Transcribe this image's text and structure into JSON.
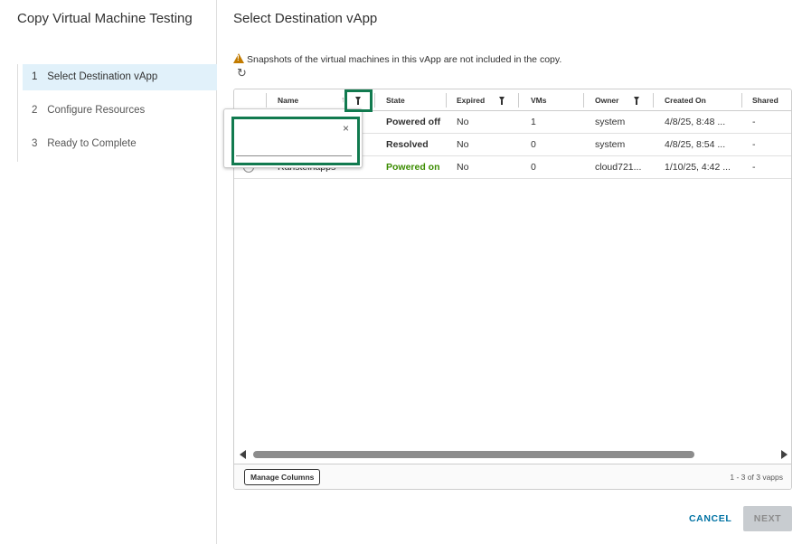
{
  "wizard": {
    "title": "Copy Virtual Machine Testing",
    "steps": [
      {
        "num": "1",
        "label": "Select Destination vApp"
      },
      {
        "num": "2",
        "label": "Configure Resources"
      },
      {
        "num": "3",
        "label": "Ready to Complete"
      }
    ]
  },
  "main": {
    "title": "Select Destination vApp",
    "warning": "Snapshots of the virtual machines in this vApp are not included in the copy.",
    "refresh_icon": "↻"
  },
  "grid": {
    "columns": {
      "name": "Name",
      "state": "State",
      "expired": "Expired",
      "vms": "VMs",
      "owner": "Owner",
      "created_on": "Created On",
      "shared": "Shared"
    },
    "sort_icon": "↑",
    "rows": [
      {
        "name": "",
        "state": "Powered off",
        "expired": "No",
        "vms": "1",
        "owner": "system",
        "created_on": "4/8/25, 8:48 ...",
        "shared": "-"
      },
      {
        "name": "",
        "state": "Resolved",
        "expired": "No",
        "vms": "0",
        "owner": "system",
        "created_on": "4/8/25, 8:54 ...",
        "shared": "-"
      },
      {
        "name": "Rahsteinapps",
        "state": "Powered on",
        "expired": "No",
        "vms": "0",
        "owner": "cloud721...",
        "created_on": "1/10/25, 4:42 ...",
        "shared": "-"
      }
    ],
    "manage_columns": "Manage Columns",
    "pager": "1 - 3 of 3 vapps"
  },
  "filter_popup": {
    "close_icon": "×",
    "value": "",
    "placeholder": ""
  },
  "footer": {
    "cancel": "CANCEL",
    "next": "NEXT"
  },
  "colors": {
    "highlight": "#117a4f",
    "accent": "#0072a3",
    "powered_on": "#3b8c00",
    "warning": "#c27b00"
  }
}
